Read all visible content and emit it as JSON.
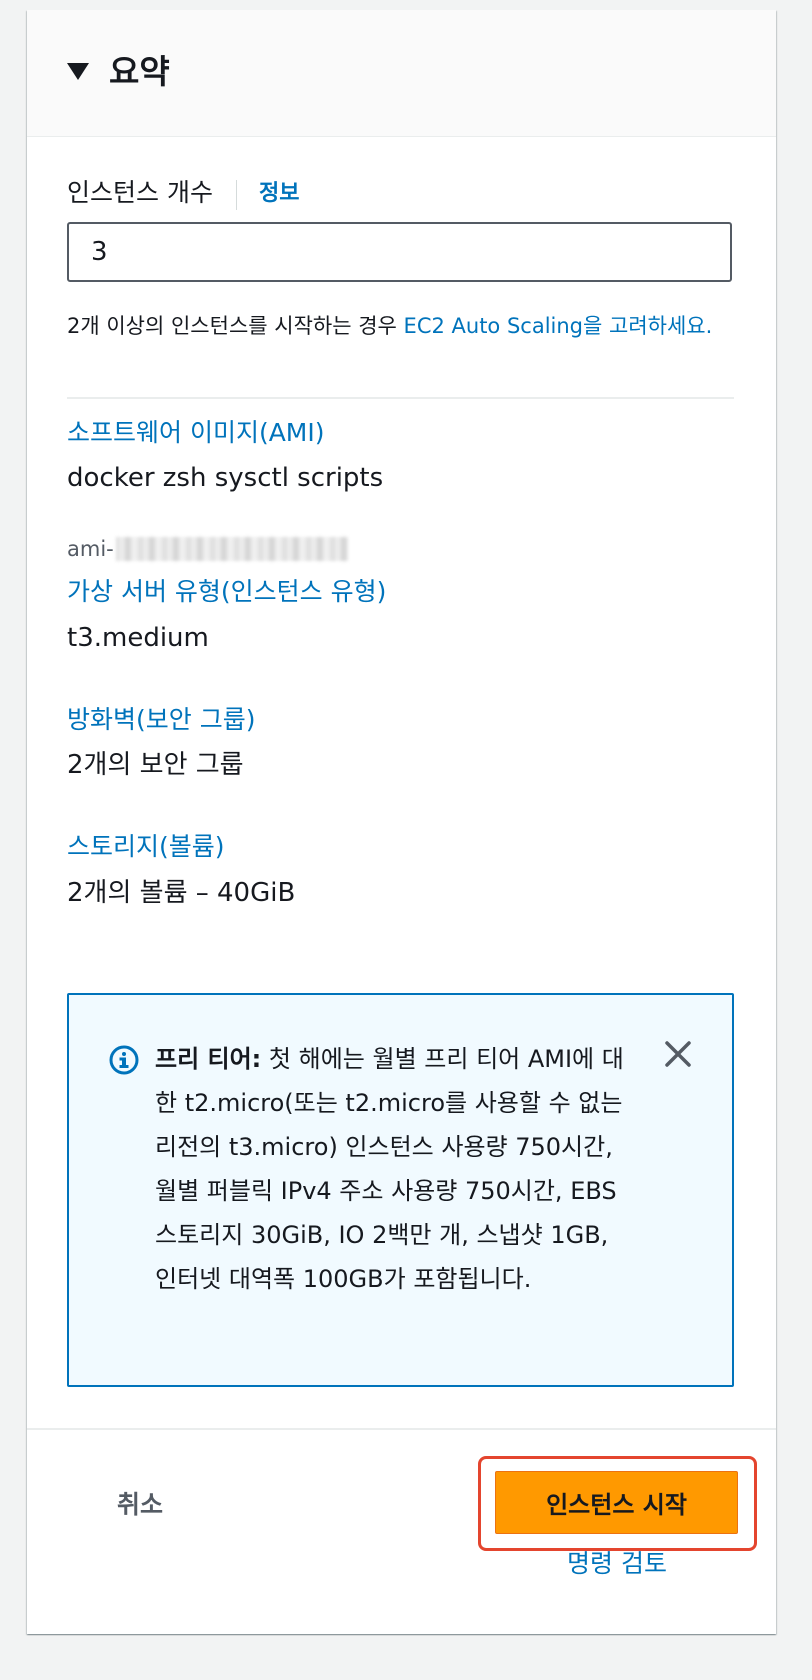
{
  "summary": {
    "header_title": "요약",
    "instance_count": {
      "label": "인스턴스 개수",
      "info_link": "정보",
      "value": "3",
      "hint_prefix": "2개 이상의 인스턴스를 시작하는 경우 ",
      "hint_link": "EC2 Auto Scaling을 고려하세요."
    },
    "ami": {
      "label": "소프트웨어 이미지(AMI)",
      "name": "docker zsh sysctl scripts",
      "id_prefix": "ami-"
    },
    "instance_type": {
      "label": "가상 서버 유형(인스턴스 유형)",
      "value": "t3.medium"
    },
    "security_group": {
      "label": "방화벽(보안 그룹)",
      "value": "2개의 보안 그룹"
    },
    "storage": {
      "label": "스토리지(볼륨)",
      "value": "2개의 볼륨 – 40GiB"
    },
    "free_tier_alert": {
      "title": "프리 티어:",
      "body": " 첫 해에는 월별 프리 티어 AMI에 대한 t2.micro(또는 t2.micro를 사용할 수 없는 리전의 t3.micro) 인스턴스 사용량 750시간, 월별 퍼블릭 IPv4 주소 사용량 750시간, EBS 스토리지 30GiB, IO 2백만 개, 스냅샷 1GB, 인터넷 대역폭 100GB가 포함됩니다."
    },
    "footer": {
      "cancel_label": "취소",
      "launch_label": "인스턴스 시작",
      "review_label": "명령 검토"
    }
  },
  "colors": {
    "link": "#0073bb",
    "primary_button": "#ff9900",
    "highlight": "#e4452e",
    "alert_bg": "#f1faff"
  },
  "icons": {
    "expand": "caret-down-icon",
    "info": "info-circle-icon",
    "close": "close-icon"
  }
}
